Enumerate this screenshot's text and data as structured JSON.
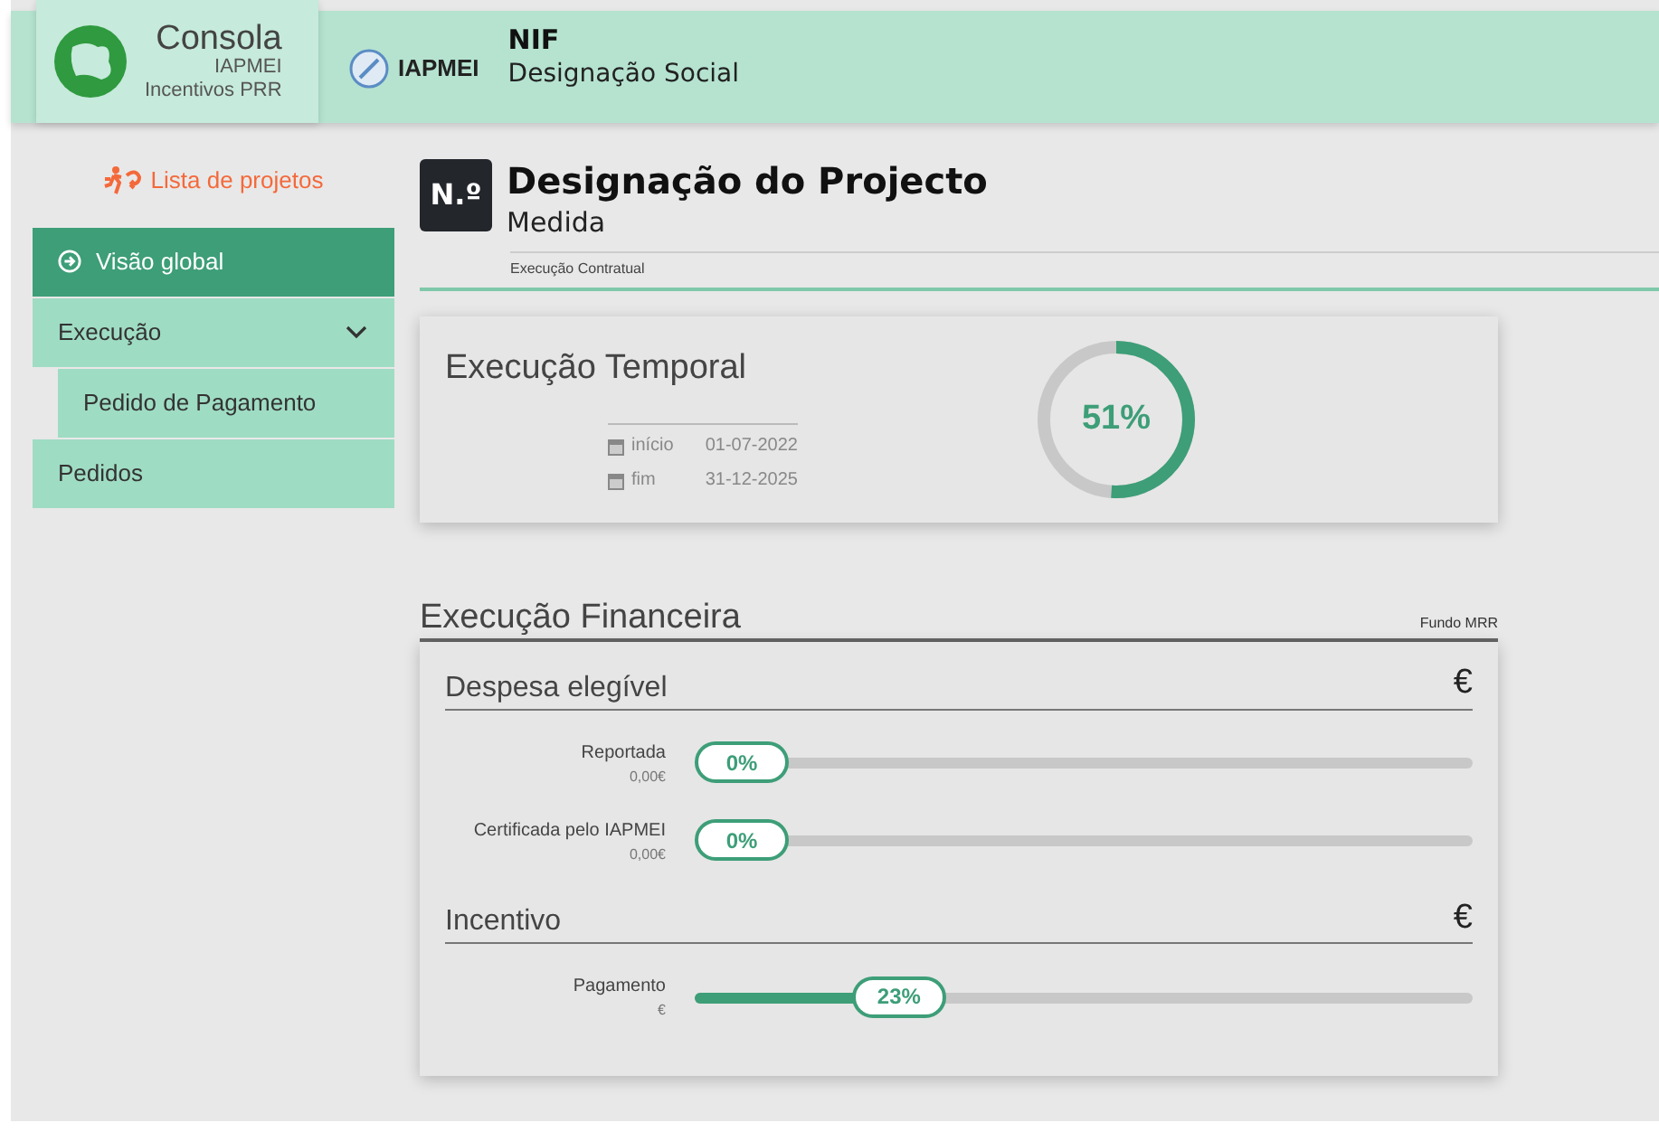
{
  "header": {
    "logo": {
      "title": "Consola",
      "line_1": "IAPMEI",
      "line_2": "Incentivos PRR"
    },
    "org": "IAPMEI",
    "nif": "NIF",
    "company": "Designação Social"
  },
  "sidebar": {
    "link": "Lista de projetos",
    "items": [
      {
        "label": "Visão global",
        "selected": true
      },
      {
        "label": "Execução",
        "selected": false,
        "expanded": true,
        "children": [
          {
            "label": "Pedido de Pagamento",
            "selected": false
          }
        ]
      },
      {
        "label": "Pedidos",
        "selected": false
      }
    ]
  },
  "project": {
    "badge": "N.º",
    "title": "Designação do Projecto",
    "subtitle": "Medida",
    "section": "Execução Contratual"
  },
  "temporal": {
    "title": "Execução Temporal",
    "dates": [
      {
        "label": "início",
        "value": "01-07-2022"
      },
      {
        "label": "fim",
        "value": "31-12-2025"
      }
    ],
    "level": 0.51,
    "reading": "51%"
  },
  "financial": {
    "title": "Execução Financeira",
    "fund": "Fundo MRR",
    "groups": [
      {
        "title": "Despesa elegível",
        "currency": "€",
        "bars": [
          {
            "label": "Reportada",
            "amount": "0,00€",
            "level": 0,
            "reading": "0%"
          },
          {
            "label": "Certificada pelo IAPMEI",
            "amount": "0,00€",
            "level": 0,
            "reading": "0%"
          }
        ]
      },
      {
        "title": "Incentivo",
        "currency": "€",
        "bars": [
          {
            "label": "Pagamento",
            "amount": "€",
            "level": 0.23,
            "reading": "23%"
          }
        ]
      }
    ]
  }
}
